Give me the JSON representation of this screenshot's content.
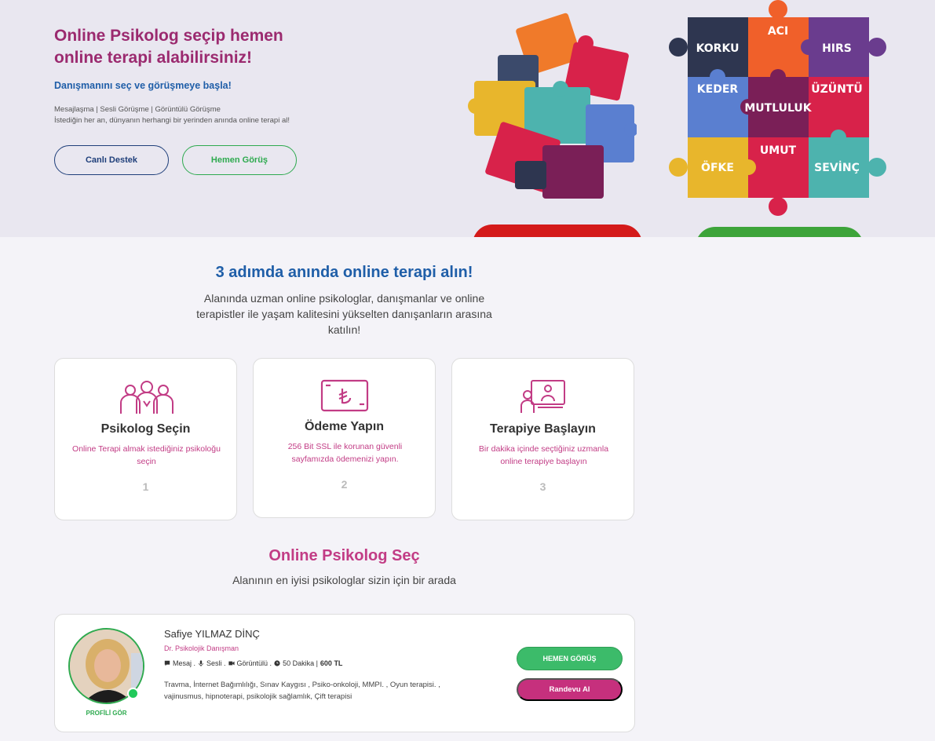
{
  "hero": {
    "title": "Online Psikolog seçip hemen online terapi alabilirsiniz!",
    "subtitle": "Danışmanını seç ve görüşmeye başla!",
    "desc_line1": "Mesajlaşma | Sesli Görüşme | Görüntülü Görüşme",
    "desc_line2": "İstediğin her an, dünyanın herhangi bir yerinden anında online terapi al!",
    "btn_support": "Canlı Destek",
    "btn_meet": "Hemen Görüş",
    "puzzle_words": [
      "KORKU",
      "ACI",
      "HIRS",
      "KEDER",
      "MUTLULUK",
      "ÜZÜNTÜ",
      "ÖFKE",
      "UMUT",
      "SEVİNÇ"
    ]
  },
  "steps": {
    "title": "3 adımda anında online terapi alın!",
    "desc": "Alanında uzman online psikologlar, danışmanlar ve online terapistler ile yaşam kalitesini yükselten danışanların arasına katılın!",
    "cards": [
      {
        "title": "Psikolog Seçin",
        "desc": "Online Terapi almak istediğiniz psikoloğu seçin",
        "num": "1",
        "icon": "group-icon"
      },
      {
        "title": "Ödeme Yapın",
        "desc": "256 Bit SSL ile korunan güvenli sayfamızda ödemenizi yapın.",
        "num": "2",
        "icon": "lira-card-icon"
      },
      {
        "title": "Terapiye Başlayın",
        "desc": "Bir dakika içinde seçtiğiniz uzmanla online terapiye başlayın",
        "num": "3",
        "icon": "video-session-icon"
      }
    ]
  },
  "psych": {
    "title": "Online Psikolog Seç",
    "subtitle": "Alanının en iyisi psikologlar sizin için bir arada",
    "doctor": {
      "name": "Safiye YILMAZ DİNÇ",
      "title": "Dr. Psikolojik Danışman",
      "meta_msg": "Mesaj .",
      "meta_voice": "Sesli .",
      "meta_video": "Görüntülü .",
      "meta_duration": "50 Dakika |",
      "price": "600 TL",
      "tags": "Travma, İnternet Bağımlılığı, Sınav Kaygısı , Psiko-onkoloji, MMPI. , Oyun terapisi. , vajinusmus, hipnoterapi, psikolojik sağlamlık, Çift terapisi",
      "profile_link": "PROFİLİ GÖR",
      "btn_meet": "HEMEN GÖRÜŞ",
      "btn_appointment": "Randevu Al"
    }
  },
  "colors": {
    "brand_purple": "#9b2a6f",
    "brand_blue": "#1f5ea8",
    "brand_pink": "#c23c85",
    "brand_green": "#2eaa4f"
  }
}
